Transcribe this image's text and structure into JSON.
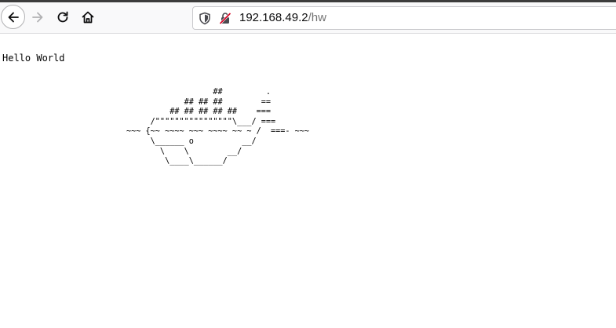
{
  "browser": {
    "url_host": "192.168.49.2",
    "url_path": "/hw",
    "icons": [
      "back-icon",
      "forward-icon",
      "reload-icon",
      "home-icon",
      "shield-icon",
      "insecure-lock-icon"
    ]
  },
  "page": {
    "greeting": "Hello World",
    "ascii_art": "                  ##         .\n            ## ## ##        ==\n         ## ## ## ## ##    ===\n     /\"\"\"\"\"\"\"\"\"\"\"\"\"\"\"\"\\___/ ===\n~~~ {~~ ~~~~ ~~~ ~~~~ ~~ ~ /  ===- ~~~\n     \\______ o          __/\n       \\    \\        __/\n        \\____\\______/"
  }
}
